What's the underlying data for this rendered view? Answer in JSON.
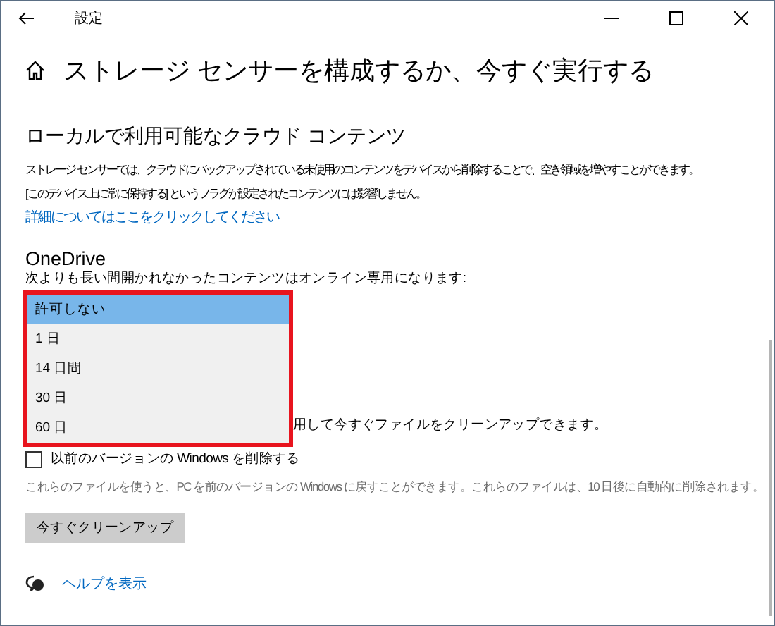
{
  "window": {
    "title": "設定"
  },
  "page": {
    "title": "ストレージ センサーを構成するか、今すぐ実行する"
  },
  "cloud_section": {
    "heading": "ローカルで利用可能なクラウド コンテンツ",
    "description": [
      "ストレージ センサーでは、クラウドにバックアップされている未使用のコンテンツをデバイスから削除することで、空き領域を増やすことができます。",
      "[このデバイス上に常に保持する] というフラグが設定されたコンテンツには影響しません。"
    ],
    "link": "詳細についてはここをクリックしてください"
  },
  "onedrive": {
    "heading": "OneDrive",
    "label": "次よりも長い間開かれなかったコンテンツはオンライン専用になります:",
    "options": [
      {
        "label": "許可しない",
        "selected": true
      },
      {
        "label": "1 日",
        "selected": false
      },
      {
        "label": "14 日間",
        "selected": false
      },
      {
        "label": "30 日",
        "selected": false
      },
      {
        "label": "60 日",
        "selected": false
      }
    ]
  },
  "partial_text": "用して今すぐファイルをクリーンアップできます。",
  "previous_windows": {
    "label": "以前のバージョンの Windows を削除する",
    "checked": false,
    "note": "これらのファイルを使うと、PC を前のバージョンの Windows に戻すことができます。これらのファイルは、10 日後に自動的に削除されます。"
  },
  "cleanup_button": "今すぐクリーンアップ",
  "help_link": "ヘルプを表示"
}
